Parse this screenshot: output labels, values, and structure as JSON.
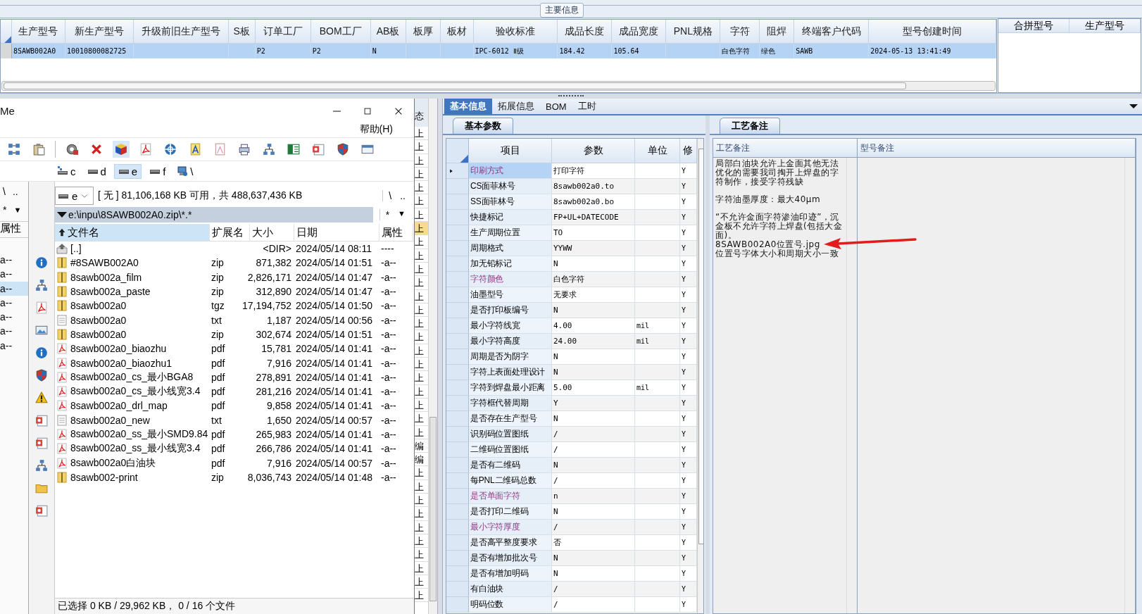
{
  "main_info": {
    "title": "主要信息",
    "columns": [
      "生产型号",
      "新生产型号",
      "升级前旧生产型号",
      "S板",
      "订单工厂",
      "BOM工厂",
      "AB板",
      "板厚",
      "板材",
      "验收标准",
      "成品长度",
      "成品宽度",
      "PNL规格",
      "字符",
      "阻焊",
      "终端客户代码",
      "型号创建时间"
    ],
    "rows": [
      {
        "selected": true,
        "cells": [
          "8SAWB002A0",
          "10010800082725",
          null,
          null,
          "P2",
          "P2",
          "N",
          null,
          null,
          "IPC-6012 Ⅱ级",
          "184.42",
          "105.64",
          null,
          "白色字符",
          "绿色",
          "SAWB",
          "2024-05-13 13:41:49"
        ]
      }
    ],
    "merge_columns": [
      "合拼型号",
      "生产型号"
    ]
  },
  "file_manager": {
    "title": "Me",
    "menu": [
      "帮助(H)"
    ],
    "drives": [
      {
        "label": "c",
        "kind": "system",
        "selected": false
      },
      {
        "label": "d",
        "kind": "disk",
        "selected": false
      },
      {
        "label": "e",
        "kind": "disk",
        "selected": true
      },
      {
        "label": "f",
        "kind": "disk",
        "selected": false
      },
      {
        "label": "\\",
        "kind": "network",
        "selected": false
      }
    ],
    "left_panel": {
      "nav": [
        "\\",
        ".."
      ],
      "filter": "*",
      "filter_arrow": "▼",
      "column": "属性",
      "rows": [
        {
          "text": "a--",
          "selected": false
        },
        {
          "text": "a--",
          "selected": false
        },
        {
          "text": "a--",
          "selected": true
        },
        {
          "text": "a--",
          "selected": false
        },
        {
          "text": "a--",
          "selected": false
        },
        {
          "text": "a--",
          "selected": false
        },
        {
          "text": "a--",
          "selected": false
        }
      ]
    },
    "drive_select": "e",
    "free_space": "[ 无 ]  81,106,168 KB 可用，共 488,637,436 KB",
    "nav": [
      "\\",
      ".."
    ],
    "path": "e:\\inpu\\8SAWB002A0.zip\\*.*",
    "filter": "*",
    "filter_arrow": "▼",
    "columns": [
      {
        "label": "文件名",
        "sorted": true
      },
      {
        "label": "扩展名",
        "sorted": false
      },
      {
        "label": "大小",
        "sorted": false
      },
      {
        "label": "日期",
        "sorted": false
      },
      {
        "label": "属性",
        "sorted": false
      }
    ],
    "files": [
      {
        "kind": "up",
        "name": "[..]",
        "size": "<DIR>",
        "date": "2024/05/14 08:11",
        "attr": "----"
      },
      {
        "kind": "archive",
        "name": "#8SAWB002A0",
        "ext": "zip",
        "size": "871,382",
        "date": "2024/05/14 01:51",
        "attr": "-a--"
      },
      {
        "kind": "archive",
        "name": "8sawb002a_film",
        "ext": "zip",
        "size": "2,826,171",
        "date": "2024/05/14 01:47",
        "attr": "-a--"
      },
      {
        "kind": "archive",
        "name": "8sawb002a_paste",
        "ext": "zip",
        "size": "312,890",
        "date": "2024/05/14 01:47",
        "attr": "-a--"
      },
      {
        "kind": "archive",
        "name": "8sawb002a0",
        "ext": "tgz",
        "size": "17,194,752",
        "date": "2024/05/14 01:50",
        "attr": "-a--"
      },
      {
        "kind": "text",
        "name": "8sawb002a0",
        "ext": "txt",
        "size": "1,187",
        "date": "2024/05/14 00:56",
        "attr": "-a--"
      },
      {
        "kind": "archive",
        "name": "8sawb002a0",
        "ext": "zip",
        "size": "302,674",
        "date": "2024/05/14 01:51",
        "attr": "-a--"
      },
      {
        "kind": "pdf",
        "name": "8sawb002a0_biaozhu",
        "ext": "pdf",
        "size": "15,781",
        "date": "2024/05/14 01:41",
        "attr": "-a--"
      },
      {
        "kind": "pdf",
        "name": "8sawb002a0_biaozhu1",
        "ext": "pdf",
        "size": "7,916",
        "date": "2024/05/14 01:41",
        "attr": "-a--"
      },
      {
        "kind": "pdf",
        "name": "8sawb002a0_cs_最小BGA8",
        "ext": "pdf",
        "size": "278,891",
        "date": "2024/05/14 01:41",
        "attr": "-a--"
      },
      {
        "kind": "pdf",
        "name": "8sawb002a0_cs_最小线宽3.4",
        "ext": "pdf",
        "size": "281,216",
        "date": "2024/05/14 01:41",
        "attr": "-a--"
      },
      {
        "kind": "pdf",
        "name": "8sawb002a0_drl_map",
        "ext": "pdf",
        "size": "9,858",
        "date": "2024/05/14 01:41",
        "attr": "-a--"
      },
      {
        "kind": "text",
        "name": "8sawb002a0_new",
        "ext": "txt",
        "size": "1,650",
        "date": "2024/05/14 00:57",
        "attr": "-a--"
      },
      {
        "kind": "pdf",
        "name": "8sawb002a0_ss_最小SMD9.84",
        "ext": "pdf",
        "size": "265,983",
        "date": "2024/05/14 01:41",
        "attr": "-a--"
      },
      {
        "kind": "pdf",
        "name": "8sawb002a0_ss_最小线宽3.4",
        "ext": "pdf",
        "size": "266,786",
        "date": "2024/05/14 01:41",
        "attr": "-a--"
      },
      {
        "kind": "pdf",
        "name": "8sawb002a0白油块",
        "ext": "pdf",
        "size": "7,916",
        "date": "2024/05/14 00:57",
        "attr": "-a--"
      },
      {
        "kind": "archive",
        "name": "8sawb002-print",
        "ext": "zip",
        "size": "8,036,743",
        "date": "2024/05/14 01:48",
        "attr": "-a--"
      }
    ],
    "status": "已选择 0 KB / 29,962 KB， 0 / 16 个文件"
  },
  "background_column": {
    "header": "态",
    "cells": [
      {
        "text": "上",
        "selected": false
      },
      {
        "text": "上",
        "selected": false
      },
      {
        "text": "上",
        "selected": false
      },
      {
        "text": "上",
        "selected": false
      },
      {
        "text": "上",
        "selected": false
      },
      {
        "text": "上",
        "selected": false
      },
      {
        "text": "上",
        "selected": false
      },
      {
        "text": "上",
        "selected": true
      },
      {
        "text": "上",
        "selected": false
      },
      {
        "text": "上",
        "selected": false
      },
      {
        "text": "上",
        "selected": false
      },
      {
        "text": "上",
        "selected": false
      },
      {
        "text": "上",
        "selected": false
      },
      {
        "text": "上",
        "selected": false
      },
      {
        "text": "上",
        "selected": false
      },
      {
        "text": "上",
        "selected": false
      },
      {
        "text": "上",
        "selected": false
      },
      {
        "text": "上",
        "selected": false
      },
      {
        "text": "上",
        "selected": false
      },
      {
        "text": "上",
        "selected": false
      },
      {
        "text": "上",
        "selected": false
      },
      {
        "text": "上",
        "selected": false
      },
      {
        "text": "上",
        "selected": false
      },
      {
        "text": "编",
        "selected": false
      },
      {
        "text": "编",
        "selected": false
      },
      {
        "text": "上",
        "selected": false
      },
      {
        "text": "上",
        "selected": false
      },
      {
        "text": "上",
        "selected": false
      },
      {
        "text": "上",
        "selected": false
      },
      {
        "text": "上",
        "selected": false
      },
      {
        "text": "上",
        "selected": false
      },
      {
        "text": "上",
        "selected": false
      },
      {
        "text": "上",
        "selected": false
      },
      {
        "text": "上",
        "selected": false
      },
      {
        "text": "上",
        "selected": false
      }
    ]
  },
  "detail": {
    "tabs": [
      {
        "label": "基本信息",
        "selected": true
      },
      {
        "label": "拓展信息",
        "selected": false
      },
      {
        "label": "BOM",
        "selected": false
      },
      {
        "label": "工时",
        "selected": false
      }
    ],
    "params": {
      "tab": "基本参数",
      "columns": [
        "项目",
        "参数",
        "单位",
        "修"
      ],
      "rows": [
        {
          "item": "印刷方式",
          "value": "打印字符",
          "flag": "Y",
          "marked": true,
          "selected": true
        },
        {
          "item": "CS面菲林号",
          "value": "8sawb002a0.to",
          "flag": "Y",
          "marked": false,
          "selected": false
        },
        {
          "item": "SS面菲林号",
          "value": "8sawb002a0.bo",
          "flag": "Y",
          "marked": false,
          "selected": false
        },
        {
          "item": "快捷标记",
          "value": "FP+UL+DATECODE",
          "flag": "Y",
          "marked": false,
          "selected": false
        },
        {
          "item": "生产周期位置",
          "value": "TO",
          "flag": "Y",
          "marked": false,
          "selected": false
        },
        {
          "item": "周期格式",
          "value": "YYWW",
          "flag": "Y",
          "marked": false,
          "selected": false
        },
        {
          "item": "加无铅标记",
          "value": "N",
          "flag": "Y",
          "marked": false,
          "selected": false
        },
        {
          "item": "字符颜色",
          "value": "白色字符",
          "flag": "Y",
          "marked": true,
          "selected": false
        },
        {
          "item": "油墨型号",
          "value": "无要求",
          "flag": "Y",
          "marked": false,
          "selected": false
        },
        {
          "item": "是否打印板编号",
          "value": "N",
          "flag": "Y",
          "marked": false,
          "selected": false
        },
        {
          "item": "最小字符线宽",
          "value": "4.00",
          "unit": "mil",
          "flag": "Y",
          "marked": false,
          "selected": false
        },
        {
          "item": "最小字符高度",
          "value": "24.00",
          "unit": "mil",
          "flag": "Y",
          "marked": false,
          "selected": false
        },
        {
          "item": "周期是否为阴字",
          "value": "N",
          "flag": "Y",
          "marked": false,
          "selected": false
        },
        {
          "item": "字符上表面处理设计",
          "value": "N",
          "flag": "Y",
          "marked": false,
          "selected": false
        },
        {
          "item": "字符到焊盘最小距离",
          "value": "5.00",
          "unit": "mil",
          "flag": "Y",
          "marked": false,
          "selected": false
        },
        {
          "item": "字符框代替周期",
          "value": "Y",
          "flag": "Y",
          "marked": false,
          "selected": false
        },
        {
          "item": "是否存在生产型号",
          "value": "N",
          "flag": "Y",
          "marked": false,
          "selected": false
        },
        {
          "item": "识别码位置图纸",
          "value": "/",
          "flag": "Y",
          "marked": false,
          "selected": false
        },
        {
          "item": "二维码位置图纸",
          "value": "/",
          "flag": "Y",
          "marked": false,
          "selected": false
        },
        {
          "item": "是否有二维码",
          "value": "N",
          "flag": "Y",
          "marked": false,
          "selected": false
        },
        {
          "item": "每PNL二维码总数",
          "value": "/",
          "flag": "Y",
          "marked": false,
          "selected": false
        },
        {
          "item": "是否单面字符",
          "value": "n",
          "flag": "Y",
          "marked": true,
          "selected": false
        },
        {
          "item": "是否打印二维码",
          "value": "N",
          "flag": "Y",
          "marked": false,
          "selected": false
        },
        {
          "item": "最小字符厚度",
          "value": "/",
          "flag": "Y",
          "marked": true,
          "selected": false
        },
        {
          "item": "是否高平整度要求",
          "value": "否",
          "flag": "Y",
          "marked": false,
          "selected": false
        },
        {
          "item": "是否有增加批次号",
          "value": "N",
          "flag": "Y",
          "marked": false,
          "selected": false
        },
        {
          "item": "是否有增加明码",
          "value": "N",
          "flag": "Y",
          "marked": false,
          "selected": false
        },
        {
          "item": "有白油块",
          "value": "/",
          "flag": "Y",
          "marked": false,
          "selected": false
        },
        {
          "item": "明码位数",
          "value": "/",
          "flag": "Y",
          "marked": false,
          "selected": false
        }
      ]
    },
    "notes": {
      "tab": "工艺备注",
      "columns": [
        "工艺备注",
        "型号备注"
      ],
      "blocks": [
        [
          "局部白油块允许上金面其他无法优化的需要我司掏开上焊盘的字符制作，接受字符残缺"
        ],
        [
          "字符油墨厚度：最大40μm"
        ],
        [
          "“不允许金面字符渗油印迹”，沉金板不允许字符上焊盘(包括大金面)。",
          "8SAWB002A0位置号.jpg",
          "位置号字体大小和周期大小一致"
        ]
      ]
    }
  }
}
